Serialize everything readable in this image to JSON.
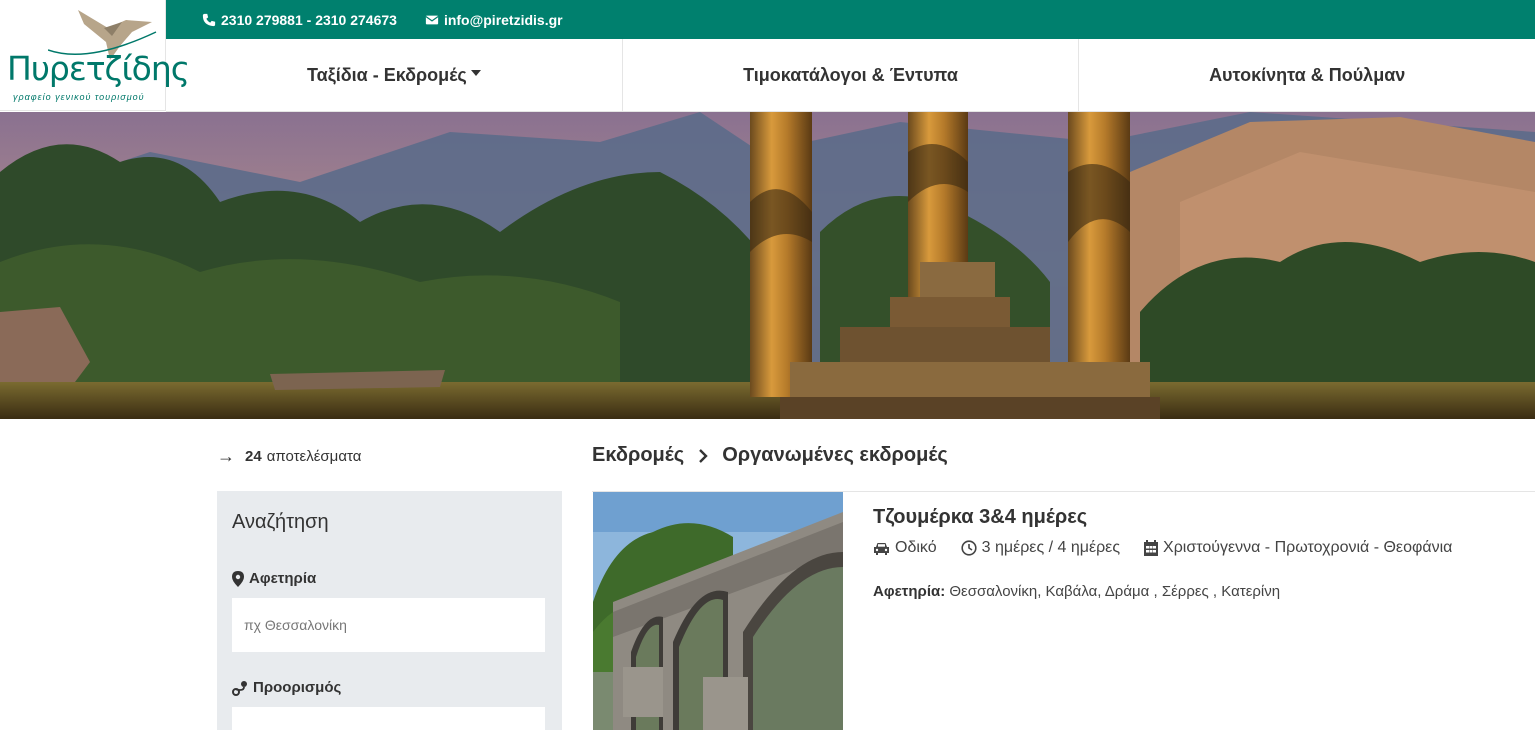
{
  "logo": {
    "brand": "Πυρετζίδης",
    "tagline": "γραφείο γενικού τουρισμού"
  },
  "topbar": {
    "phone": "2310 279881 - 2310 274673",
    "email": "info@piretzidis.gr",
    "color": "#00806e"
  },
  "nav": {
    "items": [
      {
        "label": "Ταξίδια - Εκδρομές",
        "dropdown": true
      },
      {
        "label": "Τιμοκατάλογοι & Έντυπα"
      },
      {
        "label": "Αυτοκίνητα & Πούλμαν"
      }
    ]
  },
  "results": {
    "count": "24",
    "label": "αποτελέσματα"
  },
  "search": {
    "title": "Αναζήτηση",
    "departure_label": "Αφετηρία",
    "departure_placeholder": "πχ Θεσσαλονίκη",
    "destination_label": "Προορισμός"
  },
  "breadcrumb": {
    "parent": "Εκδρομές",
    "current": "Οργανωμένες εκδρομές"
  },
  "trip": {
    "title": "Τζουμέρκα 3&4 ημέρες",
    "transport": "Οδικό",
    "duration": "3 ημέρες / 4 ημέρες",
    "period": "Χριστούγεννα - Πρωτοχρονιά - Θεοφάνια",
    "departure_label": "Αφετηρία:",
    "departure_cities": "Θεσσαλονίκη, Καβάλα, Δράμα , Σέρρες , Κατερίνη"
  }
}
